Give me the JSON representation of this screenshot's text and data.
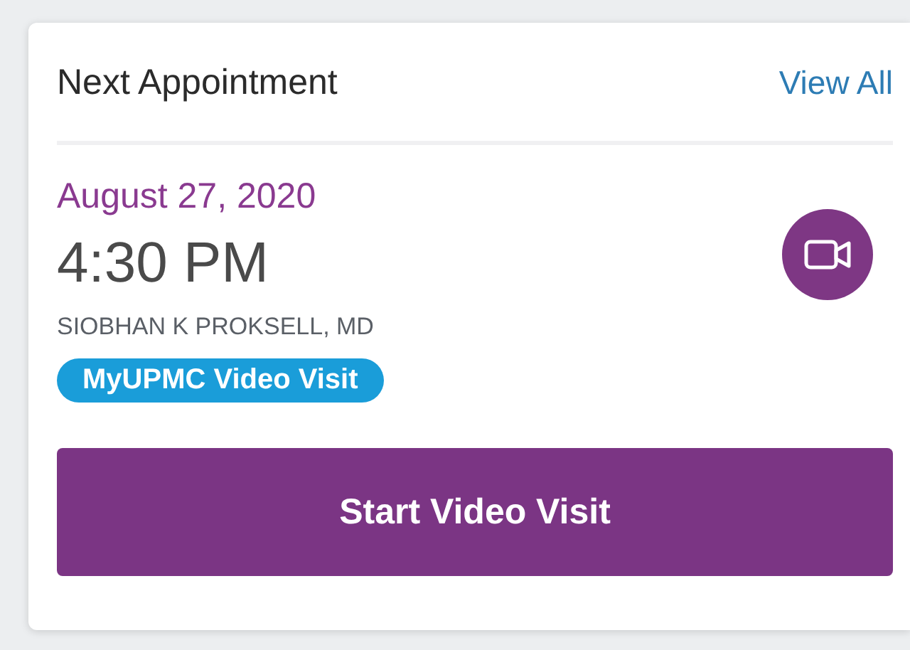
{
  "card": {
    "title": "Next Appointment",
    "link": "View All"
  },
  "appointment": {
    "date": "August 27, 2020",
    "time": "4:30 PM",
    "provider": "SIOBHAN K PROKSELL, MD",
    "badge": "MyUPMC Video Visit"
  },
  "button": {
    "label": "Start Video Visit"
  }
}
